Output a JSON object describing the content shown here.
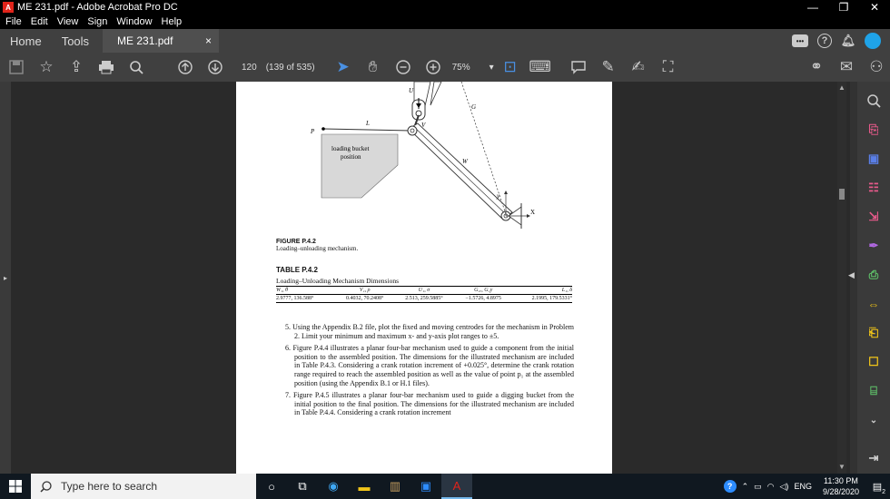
{
  "window": {
    "title": "ME 231.pdf - Adobe Acrobat Pro DC",
    "min": "—",
    "max": "❐",
    "close": "✕"
  },
  "menu": [
    "File",
    "Edit",
    "View",
    "Sign",
    "Window",
    "Help"
  ],
  "tabs": {
    "home": "Home",
    "tools": "Tools",
    "document": "ME 231.pdf",
    "close": "×"
  },
  "toolbar": {
    "page_number": "120",
    "page_count": "(139 of 535)",
    "zoom": "75%"
  },
  "figure": {
    "labels": {
      "u": "U",
      "g": "G",
      "l": "L",
      "p": "P",
      "v": "V",
      "w": "W",
      "y": "y",
      "x": "X",
      "bucket": "loading bucket",
      "position": "position"
    },
    "caption_title": "FIGURE P.4.2",
    "caption_text": "Loading–unloading mechanism."
  },
  "table": {
    "title": "TABLE P.4.2",
    "subtitle": "Loading–Unloading Mechanism Dimensions",
    "headers": [
      "W₁, θ",
      "V₁, ρ",
      "U₁, σ",
      "G₁ₓ, G₁y",
      "L₁, δ"
    ],
    "values": [
      "2.9777, 136.588°",
      "0.4032, 70.2408°",
      "2.513, 259.5885°",
      "−1.5726, 4.8975",
      "2.1995, 179.5331°"
    ]
  },
  "problems": [
    "5.  Using the Appendix B.2 file, plot the fixed and moving centrodes for the mechanism in Problem 2. Limit your minimum and maximum x- and y-axis plot ranges to ±5.",
    "6.  Figure P.4.4 illustrates a planar four-bar mechanism used to guide a component from the initial position to the assembled position. The dimensions for the illustrated mechanism are included in Table P.4.3. Considering a crank rotation increment of +0.025°, determine the crank rotation range required to reach the assembled position as well as the value of point p₁ at the assembled position (using the Appendix B.1 or H.1 files).",
    "7.  Figure P.4.5 illustrates a planar four-bar mechanism used to guide a digging bucket from the initial position to the final position. The dimensions for the illustrated mechanism are included in Table P.4.4. Considering a crank rotation increment"
  ],
  "taskbar": {
    "search_placeholder": "Type here to search",
    "lang": "ENG",
    "time": "11:30 PM",
    "date": "9/28/2020",
    "notif_count": "2"
  },
  "colors": {
    "acrobat_red": "#e0231a",
    "avatar_blue": "#1fa3e8",
    "tool_green": "#5fc36a",
    "tool_pink": "#e75a8b",
    "tool_yellow": "#f0c419"
  }
}
